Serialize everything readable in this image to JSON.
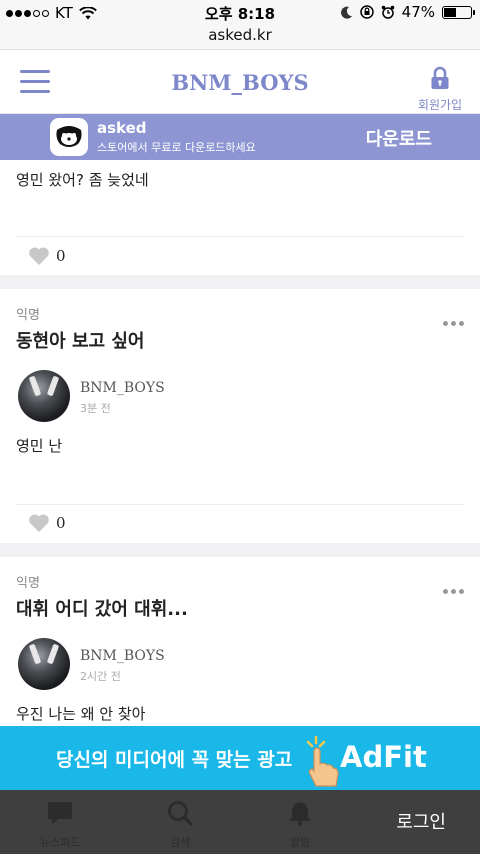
{
  "status_bar": {
    "carrier": "KT",
    "time": "오후 8:18",
    "battery": "47%",
    "battery_level": 0.47
  },
  "browser": {
    "url": "asked.kr"
  },
  "header": {
    "title": "BNM_BOYS",
    "signup_label": "회원가입"
  },
  "app_banner": {
    "name": "asked",
    "description": "스토어에서 무료로 다운로드하세요",
    "action": "다운로드"
  },
  "posts": [
    {
      "answer": "영민 왔어? 좀 늦었네",
      "likes": "0"
    },
    {
      "label": "익명",
      "question": "동현아 보고 싶어",
      "author": "BNM_BOYS",
      "time": "3분 전",
      "answer": "영민 난",
      "likes": "0"
    },
    {
      "label": "익명",
      "question": "대휘 어디 갔어 대휘...",
      "author": "BNM_BOYS",
      "time": "2시간 전",
      "answer": "우진 나는 왜 안 찾아"
    }
  ],
  "ad": {
    "text": "당신의 미디어에 꼭 맞는 광고",
    "brand": "AdFit"
  },
  "bottom_nav": {
    "items": [
      {
        "label": "뉴스피드",
        "icon": "chat-bubble-icon"
      },
      {
        "label": "검색",
        "icon": "search-icon"
      },
      {
        "label": "알림",
        "icon": "bell-icon"
      }
    ],
    "login": "로그인"
  },
  "colors": {
    "brand": "#7d87c9",
    "banner": "#8d96d3",
    "ad": "#19b8e8",
    "nav": "#3f3f3f"
  }
}
